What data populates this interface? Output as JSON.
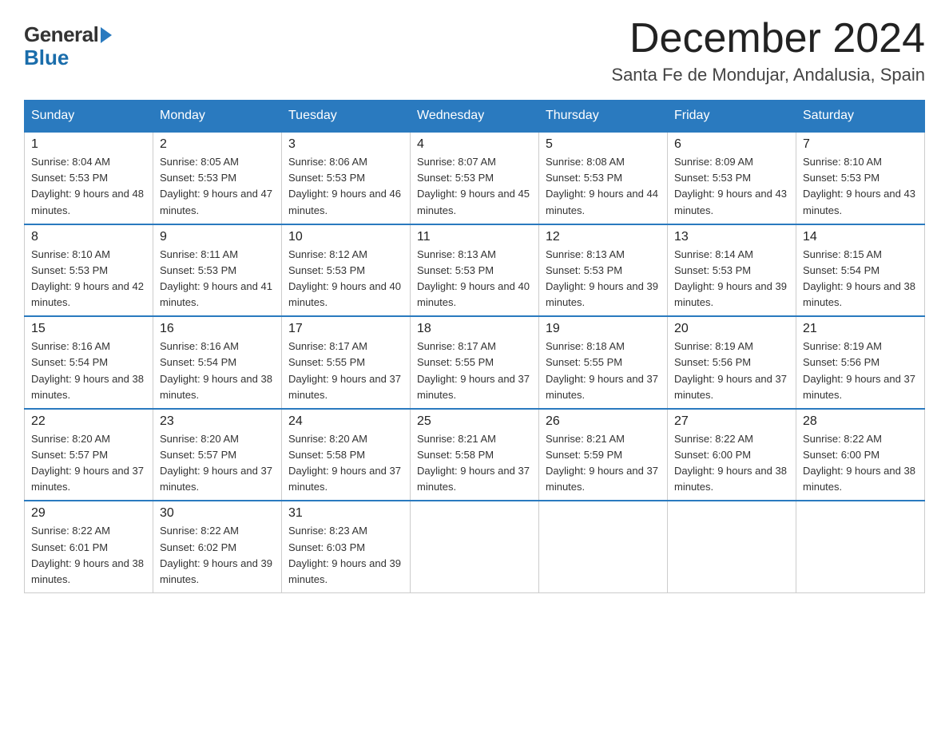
{
  "header": {
    "logo_general": "General",
    "logo_blue": "Blue",
    "month_title": "December 2024",
    "location": "Santa Fe de Mondujar, Andalusia, Spain"
  },
  "days_of_week": [
    "Sunday",
    "Monday",
    "Tuesday",
    "Wednesday",
    "Thursday",
    "Friday",
    "Saturday"
  ],
  "weeks": [
    [
      {
        "day": "1",
        "sunrise": "Sunrise: 8:04 AM",
        "sunset": "Sunset: 5:53 PM",
        "daylight": "Daylight: 9 hours and 48 minutes."
      },
      {
        "day": "2",
        "sunrise": "Sunrise: 8:05 AM",
        "sunset": "Sunset: 5:53 PM",
        "daylight": "Daylight: 9 hours and 47 minutes."
      },
      {
        "day": "3",
        "sunrise": "Sunrise: 8:06 AM",
        "sunset": "Sunset: 5:53 PM",
        "daylight": "Daylight: 9 hours and 46 minutes."
      },
      {
        "day": "4",
        "sunrise": "Sunrise: 8:07 AM",
        "sunset": "Sunset: 5:53 PM",
        "daylight": "Daylight: 9 hours and 45 minutes."
      },
      {
        "day": "5",
        "sunrise": "Sunrise: 8:08 AM",
        "sunset": "Sunset: 5:53 PM",
        "daylight": "Daylight: 9 hours and 44 minutes."
      },
      {
        "day": "6",
        "sunrise": "Sunrise: 8:09 AM",
        "sunset": "Sunset: 5:53 PM",
        "daylight": "Daylight: 9 hours and 43 minutes."
      },
      {
        "day": "7",
        "sunrise": "Sunrise: 8:10 AM",
        "sunset": "Sunset: 5:53 PM",
        "daylight": "Daylight: 9 hours and 43 minutes."
      }
    ],
    [
      {
        "day": "8",
        "sunrise": "Sunrise: 8:10 AM",
        "sunset": "Sunset: 5:53 PM",
        "daylight": "Daylight: 9 hours and 42 minutes."
      },
      {
        "day": "9",
        "sunrise": "Sunrise: 8:11 AM",
        "sunset": "Sunset: 5:53 PM",
        "daylight": "Daylight: 9 hours and 41 minutes."
      },
      {
        "day": "10",
        "sunrise": "Sunrise: 8:12 AM",
        "sunset": "Sunset: 5:53 PM",
        "daylight": "Daylight: 9 hours and 40 minutes."
      },
      {
        "day": "11",
        "sunrise": "Sunrise: 8:13 AM",
        "sunset": "Sunset: 5:53 PM",
        "daylight": "Daylight: 9 hours and 40 minutes."
      },
      {
        "day": "12",
        "sunrise": "Sunrise: 8:13 AM",
        "sunset": "Sunset: 5:53 PM",
        "daylight": "Daylight: 9 hours and 39 minutes."
      },
      {
        "day": "13",
        "sunrise": "Sunrise: 8:14 AM",
        "sunset": "Sunset: 5:53 PM",
        "daylight": "Daylight: 9 hours and 39 minutes."
      },
      {
        "day": "14",
        "sunrise": "Sunrise: 8:15 AM",
        "sunset": "Sunset: 5:54 PM",
        "daylight": "Daylight: 9 hours and 38 minutes."
      }
    ],
    [
      {
        "day": "15",
        "sunrise": "Sunrise: 8:16 AM",
        "sunset": "Sunset: 5:54 PM",
        "daylight": "Daylight: 9 hours and 38 minutes."
      },
      {
        "day": "16",
        "sunrise": "Sunrise: 8:16 AM",
        "sunset": "Sunset: 5:54 PM",
        "daylight": "Daylight: 9 hours and 38 minutes."
      },
      {
        "day": "17",
        "sunrise": "Sunrise: 8:17 AM",
        "sunset": "Sunset: 5:55 PM",
        "daylight": "Daylight: 9 hours and 37 minutes."
      },
      {
        "day": "18",
        "sunrise": "Sunrise: 8:17 AM",
        "sunset": "Sunset: 5:55 PM",
        "daylight": "Daylight: 9 hours and 37 minutes."
      },
      {
        "day": "19",
        "sunrise": "Sunrise: 8:18 AM",
        "sunset": "Sunset: 5:55 PM",
        "daylight": "Daylight: 9 hours and 37 minutes."
      },
      {
        "day": "20",
        "sunrise": "Sunrise: 8:19 AM",
        "sunset": "Sunset: 5:56 PM",
        "daylight": "Daylight: 9 hours and 37 minutes."
      },
      {
        "day": "21",
        "sunrise": "Sunrise: 8:19 AM",
        "sunset": "Sunset: 5:56 PM",
        "daylight": "Daylight: 9 hours and 37 minutes."
      }
    ],
    [
      {
        "day": "22",
        "sunrise": "Sunrise: 8:20 AM",
        "sunset": "Sunset: 5:57 PM",
        "daylight": "Daylight: 9 hours and 37 minutes."
      },
      {
        "day": "23",
        "sunrise": "Sunrise: 8:20 AM",
        "sunset": "Sunset: 5:57 PM",
        "daylight": "Daylight: 9 hours and 37 minutes."
      },
      {
        "day": "24",
        "sunrise": "Sunrise: 8:20 AM",
        "sunset": "Sunset: 5:58 PM",
        "daylight": "Daylight: 9 hours and 37 minutes."
      },
      {
        "day": "25",
        "sunrise": "Sunrise: 8:21 AM",
        "sunset": "Sunset: 5:58 PM",
        "daylight": "Daylight: 9 hours and 37 minutes."
      },
      {
        "day": "26",
        "sunrise": "Sunrise: 8:21 AM",
        "sunset": "Sunset: 5:59 PM",
        "daylight": "Daylight: 9 hours and 37 minutes."
      },
      {
        "day": "27",
        "sunrise": "Sunrise: 8:22 AM",
        "sunset": "Sunset: 6:00 PM",
        "daylight": "Daylight: 9 hours and 38 minutes."
      },
      {
        "day": "28",
        "sunrise": "Sunrise: 8:22 AM",
        "sunset": "Sunset: 6:00 PM",
        "daylight": "Daylight: 9 hours and 38 minutes."
      }
    ],
    [
      {
        "day": "29",
        "sunrise": "Sunrise: 8:22 AM",
        "sunset": "Sunset: 6:01 PM",
        "daylight": "Daylight: 9 hours and 38 minutes."
      },
      {
        "day": "30",
        "sunrise": "Sunrise: 8:22 AM",
        "sunset": "Sunset: 6:02 PM",
        "daylight": "Daylight: 9 hours and 39 minutes."
      },
      {
        "day": "31",
        "sunrise": "Sunrise: 8:23 AM",
        "sunset": "Sunset: 6:03 PM",
        "daylight": "Daylight: 9 hours and 39 minutes."
      },
      null,
      null,
      null,
      null
    ]
  ]
}
